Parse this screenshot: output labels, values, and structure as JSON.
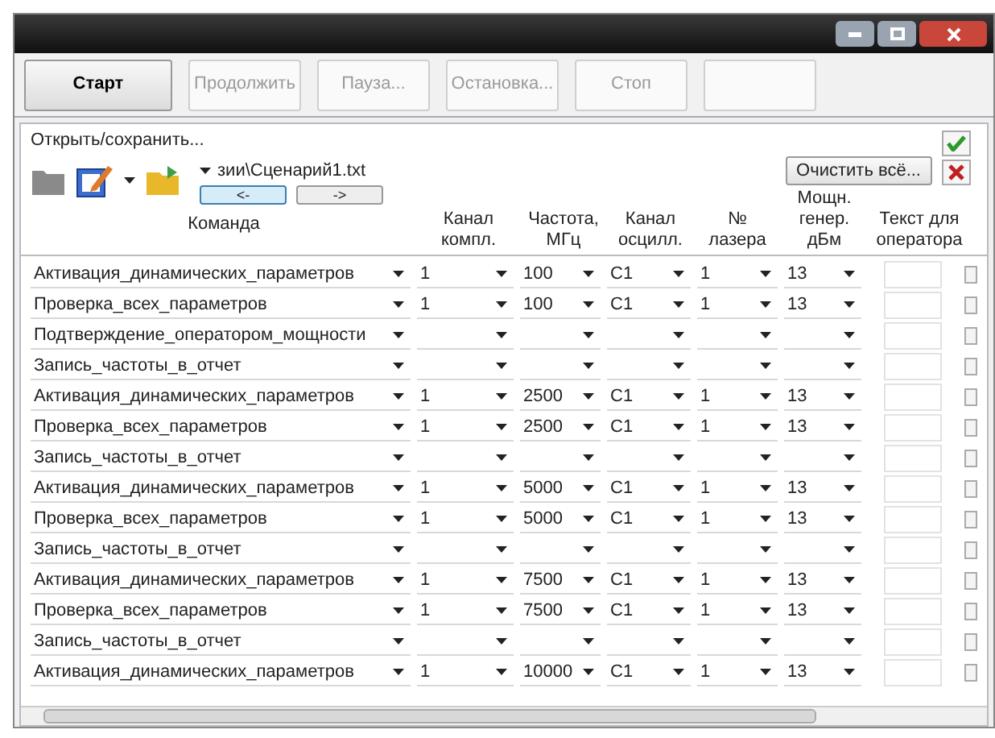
{
  "toolbar": {
    "buttons": [
      {
        "label": "Старт",
        "disabled": false
      },
      {
        "label": "Продолжить",
        "disabled": true
      },
      {
        "label": "Пауза...",
        "disabled": true
      },
      {
        "label": "Остановка...",
        "disabled": true
      },
      {
        "label": "Стоп",
        "disabled": true
      },
      {
        "disabled": true
      }
    ]
  },
  "file": {
    "label": "Открыть/сохранить...",
    "path": "зии\\Сценарий1.txt",
    "back": "<-",
    "forward": "->",
    "clear": "Очистить всё..."
  },
  "table": {
    "columns": [
      "Команда",
      "Канал компл.",
      "Частота, МГц",
      "Канал осцилл.",
      "№ лазера",
      "Мощн. генер. дБм",
      "Текст для оператора"
    ],
    "rows": [
      {
        "command": "Активация_динамических_параметров",
        "channel": "1",
        "freq": "100",
        "osc": "C1",
        "laser": "1",
        "power": "13",
        "checked": false
      },
      {
        "command": "Проверка_всех_параметров",
        "channel": "1",
        "freq": "100",
        "osc": "C1",
        "laser": "1",
        "power": "13",
        "checked": false
      },
      {
        "command": "Подтверждение_оператором_мощности",
        "checked": false
      },
      {
        "command": "Запись_частоты_в_отчет",
        "checked": false
      },
      {
        "command": "Активация_динамических_параметров",
        "channel": "1",
        "freq": "2500",
        "osc": "C1",
        "laser": "1",
        "power": "13",
        "checked": false
      },
      {
        "command": "Проверка_всех_параметров",
        "channel": "1",
        "freq": "2500",
        "osc": "C1",
        "laser": "1",
        "power": "13",
        "checked": false
      },
      {
        "command": "Запись_частоты_в_отчет",
        "checked": false
      },
      {
        "command": "Активация_динамических_параметров",
        "channel": "1",
        "freq": "5000",
        "osc": "C1",
        "laser": "1",
        "power": "13",
        "checked": false
      },
      {
        "command": "Проверка_всех_параметров",
        "channel": "1",
        "freq": "5000",
        "osc": "C1",
        "laser": "1",
        "power": "13",
        "checked": false
      },
      {
        "command": "Запись_частоты_в_отчет",
        "checked": false
      },
      {
        "command": "Активация_динамических_параметров",
        "channel": "1",
        "freq": "7500",
        "osc": "C1",
        "laser": "1",
        "power": "13",
        "checked": false
      },
      {
        "command": "Проверка_всех_параметров",
        "channel": "1",
        "freq": "7500",
        "osc": "C1",
        "laser": "1",
        "power": "13",
        "checked": false
      },
      {
        "command": "Запись_частоты_в_отчет",
        "checked": false
      },
      {
        "command": "Активация_динамических_параметров",
        "channel": "1",
        "freq": "10000",
        "osc": "C1",
        "laser": "1",
        "power": "13",
        "checked": false
      }
    ]
  }
}
